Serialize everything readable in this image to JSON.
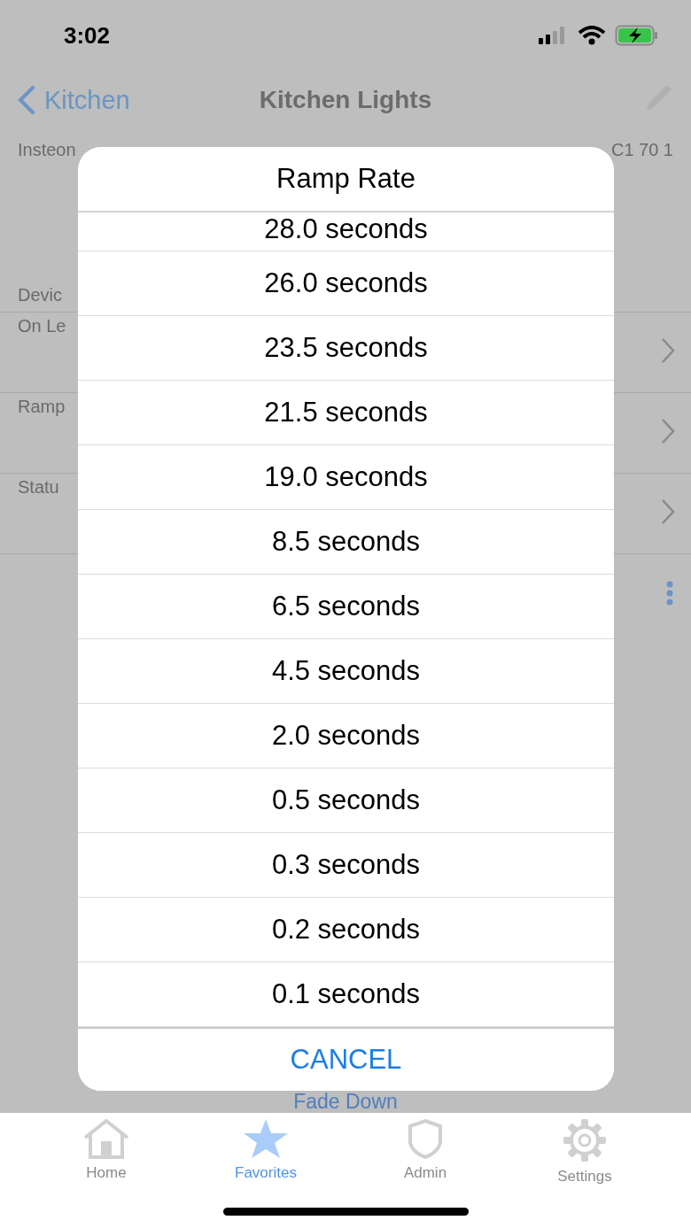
{
  "status_bar": {
    "time": "3:02"
  },
  "nav": {
    "back": "Kitchen",
    "title": "Kitchen Lights"
  },
  "device": {
    "label": "Insteon",
    "address": "C1 70 1"
  },
  "section": {
    "header": "Devic"
  },
  "rows": [
    {
      "label": "On Le"
    },
    {
      "label": "Ramp"
    },
    {
      "label": "Statu"
    }
  ],
  "fade_button": "Fade Down",
  "dialog": {
    "title": "Ramp Rate",
    "options": [
      {
        "label": "28.0 seconds"
      },
      {
        "label": "26.0 seconds"
      },
      {
        "label": "23.5 seconds"
      },
      {
        "label": "21.5 seconds"
      },
      {
        "label": "19.0 seconds"
      },
      {
        "label": "8.5 seconds"
      },
      {
        "label": "6.5 seconds"
      },
      {
        "label": "4.5 seconds"
      },
      {
        "label": "2.0 seconds"
      },
      {
        "label": "0.5 seconds"
      },
      {
        "label": "0.3 seconds"
      },
      {
        "label": "0.2 seconds"
      },
      {
        "label": "0.1 seconds"
      }
    ],
    "cancel": "CANCEL"
  },
  "tabs": [
    {
      "label": "Home",
      "selected": false
    },
    {
      "label": "Favorites",
      "selected": true
    },
    {
      "label": "Admin",
      "selected": false
    },
    {
      "label": "Settings",
      "selected": false
    }
  ]
}
